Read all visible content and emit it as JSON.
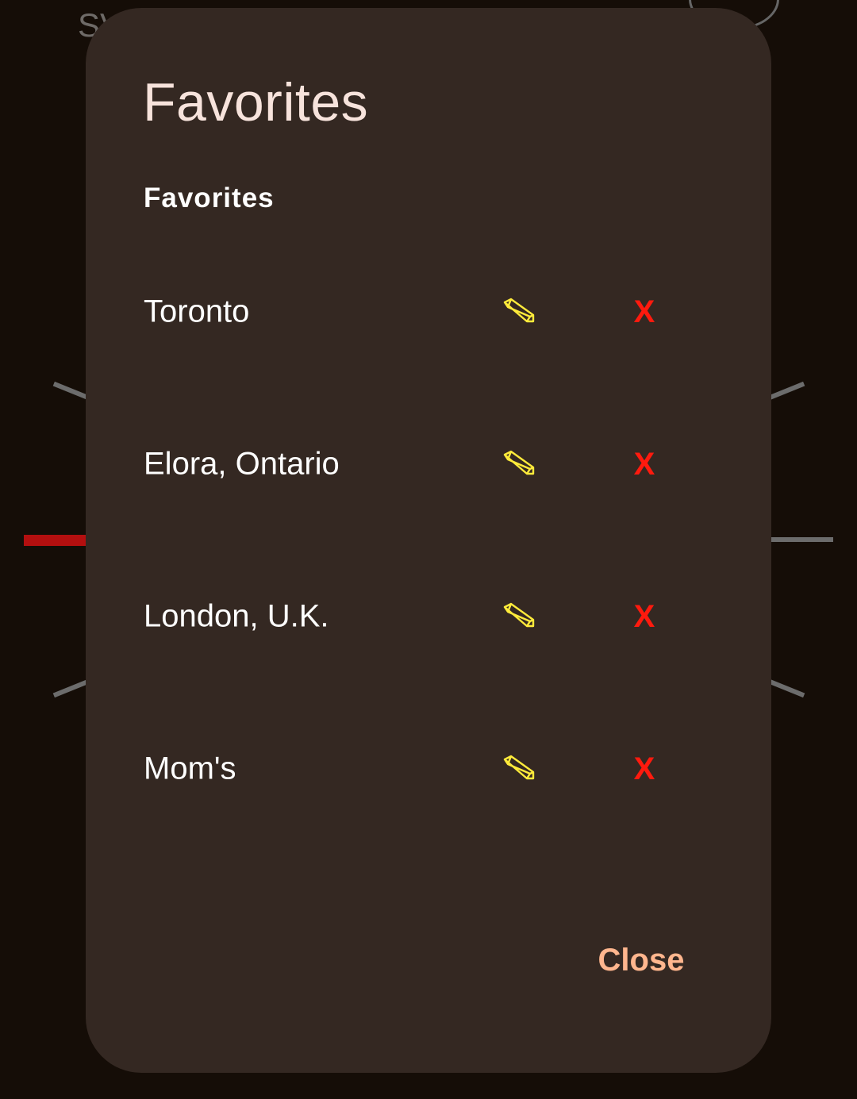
{
  "background": {
    "partial_text": "SV"
  },
  "dialog": {
    "title": "Favorites",
    "section_header": "Favorites",
    "favorites": [
      {
        "name": "Toronto",
        "edit_icon": "pencil-icon",
        "delete_label": "X"
      },
      {
        "name": "Elora, Ontario",
        "edit_icon": "pencil-icon",
        "delete_label": "X"
      },
      {
        "name": "London, U.K.",
        "edit_icon": "pencil-icon",
        "delete_label": "X"
      },
      {
        "name": "Mom's",
        "edit_icon": "pencil-icon",
        "delete_label": "X"
      }
    ],
    "close_label": "Close"
  },
  "colors": {
    "dialog_bg": "#342822",
    "edit_icon": "#ffeb3b",
    "delete": "#ff1a0e",
    "close": "#ffb68e",
    "title": "#f7e3dc"
  }
}
